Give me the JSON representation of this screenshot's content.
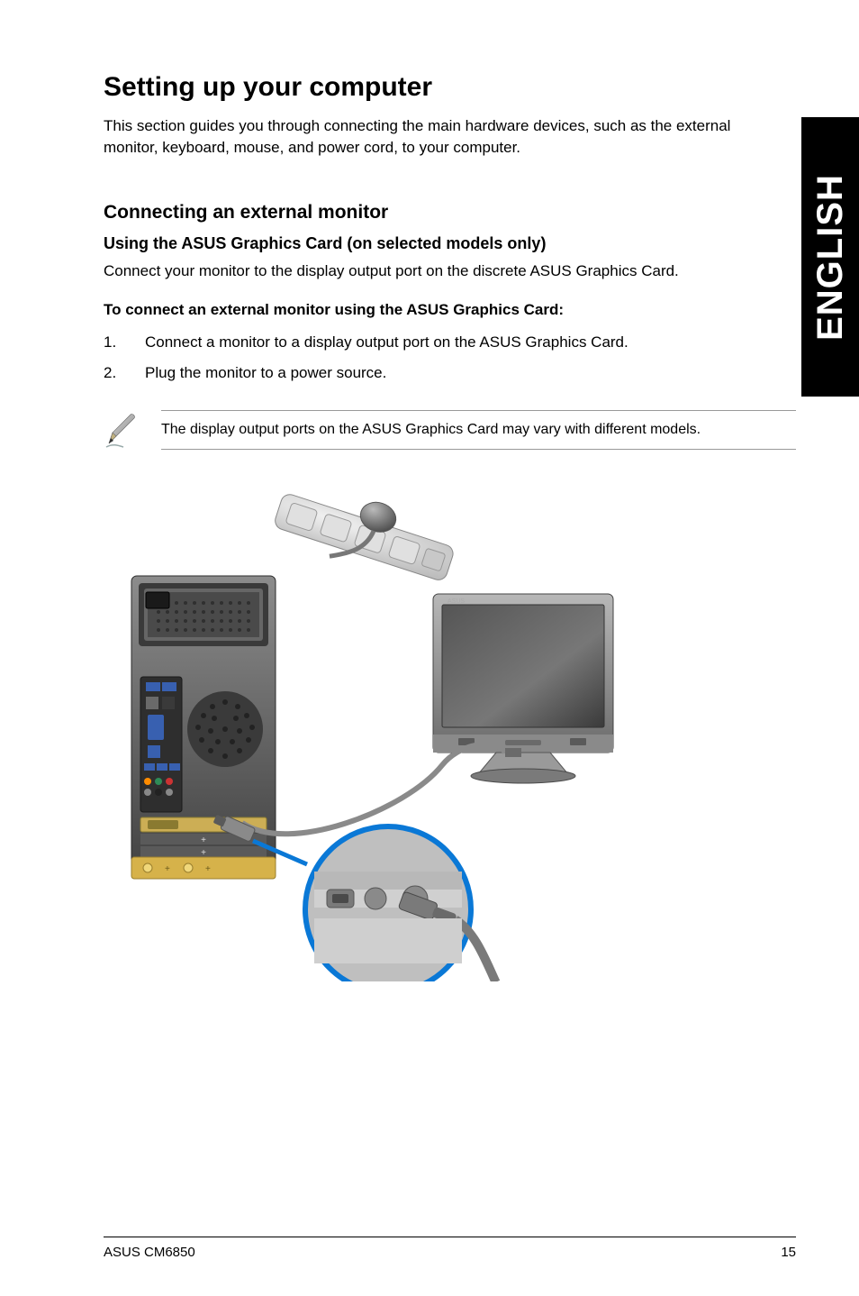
{
  "sideTab": "ENGLISH",
  "h1": "Setting up your computer",
  "intro": "This section guides you through connecting the main hardware devices, such as the external monitor, keyboard, mouse, and power cord, to your computer.",
  "h2": "Connecting an external monitor",
  "h3": "Using the ASUS Graphics Card (on selected models only)",
  "p1": "Connect your monitor to the display output port on the discrete ASUS Graphics Card.",
  "h4": "To connect an external monitor using the ASUS Graphics Card:",
  "steps": [
    {
      "n": "1.",
      "t": "Connect a monitor to a display output port on the ASUS Graphics Card."
    },
    {
      "n": "2.",
      "t": "Plug the monitor to a power source."
    }
  ],
  "note": "The display output ports on the ASUS Graphics Card may vary with different models.",
  "footer": {
    "left": "ASUS CM6850",
    "right": "15"
  }
}
